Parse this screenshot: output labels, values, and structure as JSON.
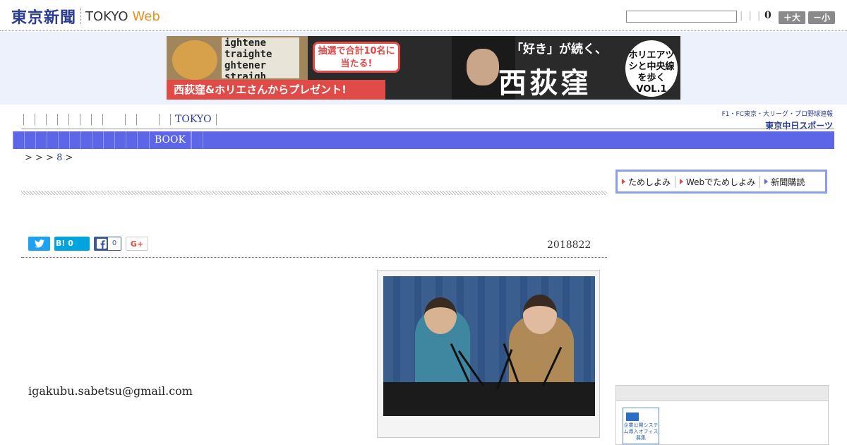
{
  "header": {
    "logo_kanji": "東京新聞",
    "logo_tokyo": "TOKYO",
    "logo_web": "Web",
    "search_placeholder": "",
    "separators": "| | |",
    "font_size_value": "0",
    "size_up_label": "＋大",
    "size_down_label": "－小"
  },
  "banner": {
    "texts": "ightene\ntraighte\nghtener\nstraigh",
    "bubble": "抽選で合計10名に当たる!",
    "ribbon": "西荻窪&ホリエさんからプレゼント!",
    "tagline": "「好き」が続く、",
    "town": "西荻窪",
    "circle": "ホリエアツシと中央線を歩く VOL.1"
  },
  "nav": {
    "tokyo_label": "TOKYO",
    "sports_topline": "F1・FC東京・大リーグ・プロ野球速報",
    "sports_name": "東京中日スポーツ"
  },
  "section_bar": {
    "book_label": "BOOK"
  },
  "breadcrumb": {
    "prefix": "> > >",
    "page": "8",
    "suffix": ">"
  },
  "subscription": {
    "items": [
      "ためしよみ",
      "Webでためしよみ",
      "新聞購読"
    ]
  },
  "share": {
    "hatena_label": "B! 0",
    "facebook_count": "0",
    "gplus_label": "G+"
  },
  "article": {
    "date": "2018822",
    "contact_email": "igakubu.sabetsu@gmail.com"
  },
  "sidebar": {
    "badge_text": "企業公開システム導入オフィス募集"
  },
  "colors": {
    "brand_blue": "#2a3d8f",
    "section_bar": "#5c66e6",
    "accent_orange": "#e8901c",
    "banner_red": "#e04b48"
  },
  "icons": [
    "twitter-icon",
    "hatena-icon",
    "facebook-icon",
    "google-plus-icon"
  ]
}
